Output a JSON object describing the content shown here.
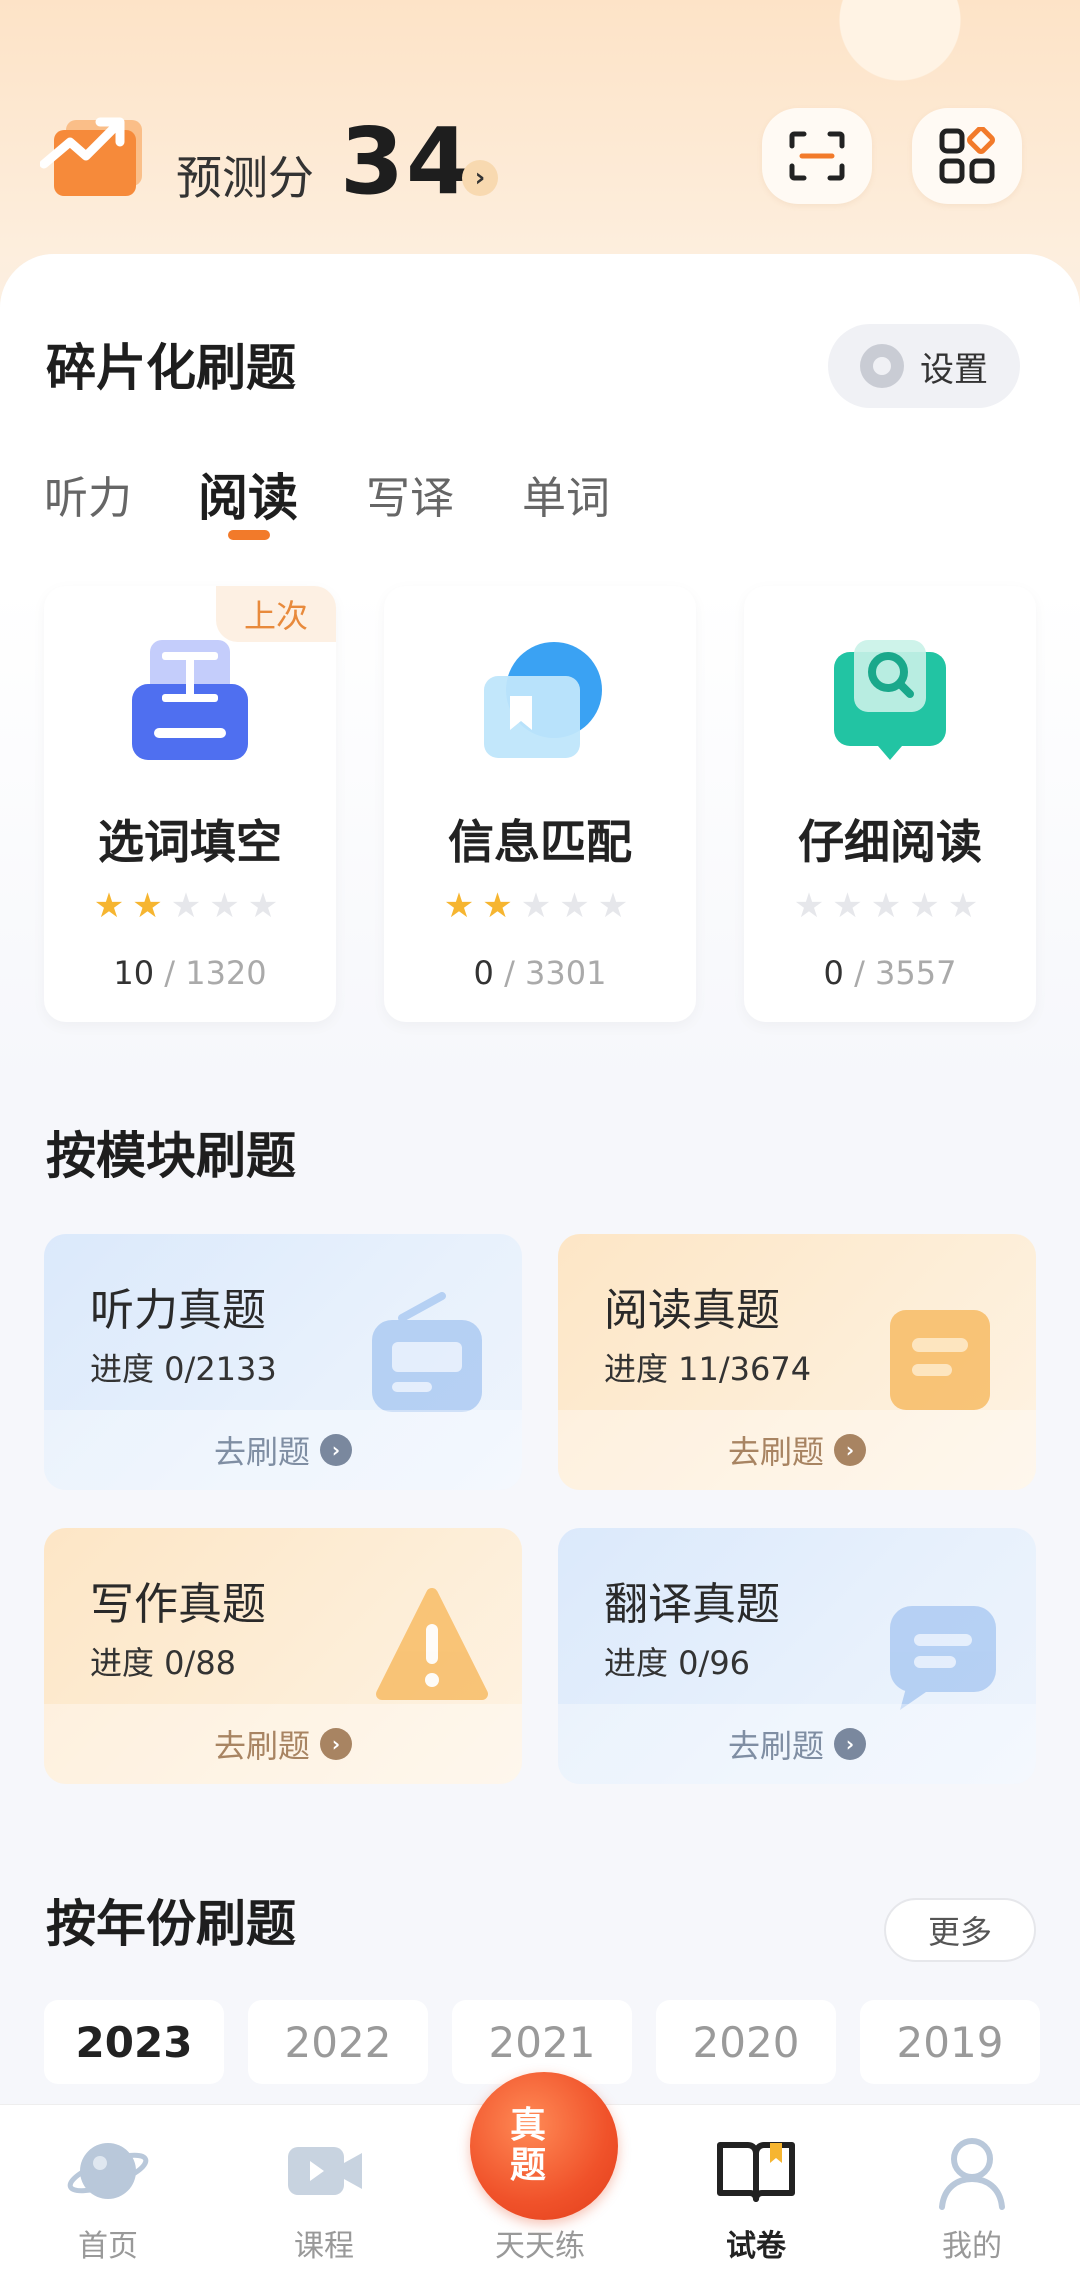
{
  "header": {
    "score_label": "预测分",
    "score_value": "34",
    "score_arrow": "›",
    "scan_icon": "scan-icon",
    "apps_icon": "apps-grid-icon"
  },
  "fragment": {
    "title": "碎片化刷题",
    "settings_label": "设置",
    "tabs": [
      {
        "label": "听力",
        "active": false
      },
      {
        "label": "阅读",
        "active": true
      },
      {
        "label": "写译",
        "active": false
      },
      {
        "label": "单词",
        "active": false
      }
    ],
    "cards": [
      {
        "title": "选词填空",
        "stars": 2,
        "max_stars": 5,
        "done": "10",
        "total": "1320",
        "badge": "上次",
        "icon": "fill-blank-icon"
      },
      {
        "title": "信息匹配",
        "stars": 2,
        "max_stars": 5,
        "done": "0",
        "total": "3301",
        "icon": "match-icon"
      },
      {
        "title": "仔细阅读",
        "stars": 0,
        "max_stars": 5,
        "done": "0",
        "total": "3557",
        "icon": "careful-read-icon"
      }
    ]
  },
  "modules": {
    "title": "按模块刷题",
    "items": [
      {
        "title": "听力真题",
        "progress": "进度 0/2133",
        "action": "去刷题",
        "theme": "blue",
        "icon": "radio-icon"
      },
      {
        "title": "阅读真题",
        "progress": "进度 11/3674",
        "action": "去刷题",
        "theme": "orange",
        "icon": "book-icon"
      },
      {
        "title": "写作真题",
        "progress": "进度 0/88",
        "action": "去刷题",
        "theme": "orange",
        "icon": "alert-icon"
      },
      {
        "title": "翻译真题",
        "progress": "进度 0/96",
        "action": "去刷题",
        "theme": "blue",
        "icon": "chat-icon"
      }
    ]
  },
  "years": {
    "title": "按年份刷题",
    "more_label": "更多",
    "items": [
      {
        "label": "2023",
        "active": true
      },
      {
        "label": "2022",
        "active": false
      },
      {
        "label": "2021",
        "active": false
      },
      {
        "label": "2020",
        "active": false
      },
      {
        "label": "2019",
        "active": false
      }
    ]
  },
  "nav": {
    "items": [
      {
        "label": "首页",
        "icon": "planet-icon",
        "active": false
      },
      {
        "label": "课程",
        "icon": "video-icon",
        "active": false
      },
      {
        "label": "天天练",
        "icon": "daily-practice-icon",
        "active": false
      },
      {
        "label": "试卷",
        "icon": "open-book-icon",
        "active": true
      },
      {
        "label": "我的",
        "icon": "profile-icon",
        "active": false
      }
    ],
    "fab_label": "真题"
  },
  "colors": {
    "accent": "#f27a2a",
    "star_on": "#f6b530",
    "star_off": "#e6e7eb"
  }
}
